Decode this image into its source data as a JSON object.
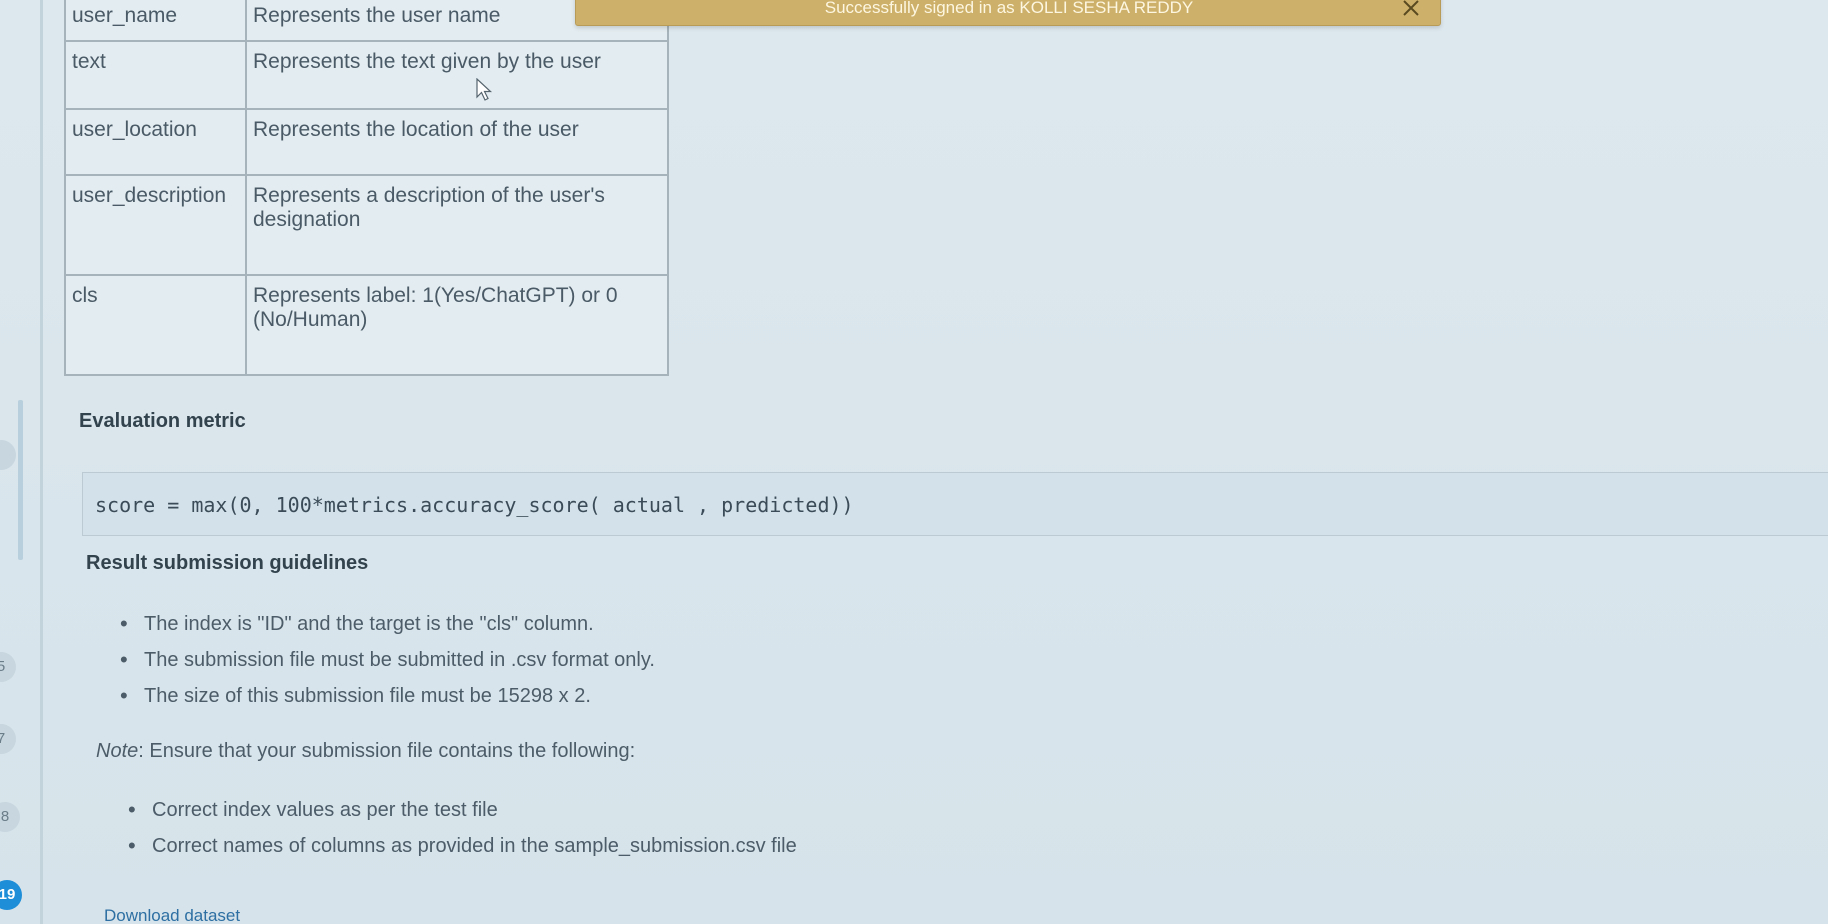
{
  "toast": {
    "message": "Successfully signed in as KOLLI SESHA REDDY",
    "close_icon": "close-icon"
  },
  "steps": {
    "labels": [
      "",
      "5",
      "7",
      "8",
      "19"
    ],
    "active_label": "19"
  },
  "attributes_table": {
    "rows": [
      {
        "name": "user_name",
        "description": "Represents the user name"
      },
      {
        "name": "text",
        "description": "Represents the text given by the user"
      },
      {
        "name": "user_location",
        "description": "Represents the location of the user"
      },
      {
        "name": "user_description",
        "description": "Represents a description of the user's designation"
      },
      {
        "name": "cls",
        "description": "Represents label: 1(Yes/ChatGPT) or 0 (No/Human)"
      }
    ]
  },
  "evaluation": {
    "heading": "Evaluation metric",
    "code": "score = max(0, 100*metrics.accuracy_score( actual , predicted))"
  },
  "submission": {
    "heading": "Result submission guidelines",
    "bullets": [
      "The index is \"ID\" and the target is the \"cls\" column.",
      "The submission file must be submitted in .csv format only.",
      "The size of this submission file must be  15298 x 2."
    ],
    "note_label": "Note",
    "note_text": ": Ensure that your submission file contains the following:",
    "note_bullets": [
      "Correct index values as per the test file",
      "Correct names of columns as provided in the sample_submission.csv file"
    ]
  },
  "download_link": "Download dataset"
}
